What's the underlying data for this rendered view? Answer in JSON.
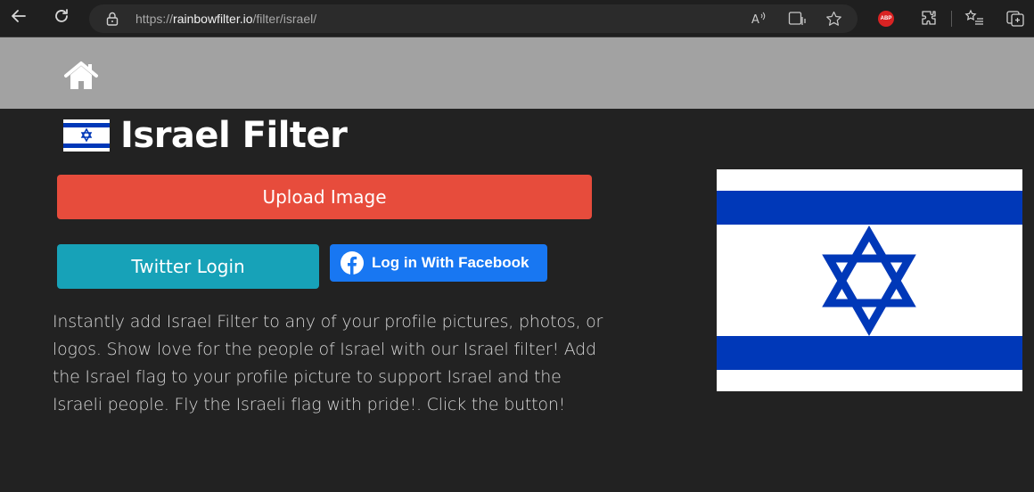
{
  "browser": {
    "url_protocol": "https://",
    "url_domain": "rainbowfilter.io",
    "url_path": "/filter/israel/",
    "adblock_label": "ABP"
  },
  "page": {
    "title": "Israel Filter",
    "upload_label": "Upload Image",
    "twitter_label": "Twitter Login",
    "facebook_label": "Log in With Facebook",
    "description": "Instantly add Israel Filter to any of your profile pictures, photos, or logos. Show love for the people of Israel with our Israel filter! Add the Israel flag to your profile picture to support Israel and the Israeli people. Fly the Israeli flag with pride!. Click the button!"
  },
  "icons": {
    "back": "back-arrow-icon",
    "refresh": "refresh-icon",
    "lock": "lock-icon",
    "read_aloud": "read-aloud-icon",
    "immersive_reader": "immersive-reader-icon",
    "favorite": "star-icon",
    "extensions": "extensions-icon",
    "favorites_list": "favorites-list-icon",
    "collections": "collections-icon",
    "home": "home-icon",
    "facebook": "facebook-icon",
    "flag": "israel-flag-icon"
  },
  "colors": {
    "upload": "#e74c3c",
    "twitter": "#17a2b8",
    "facebook": "#1877f2",
    "header": "#a2a2a2",
    "background": "#222222",
    "flag_blue": "#0038b8"
  }
}
